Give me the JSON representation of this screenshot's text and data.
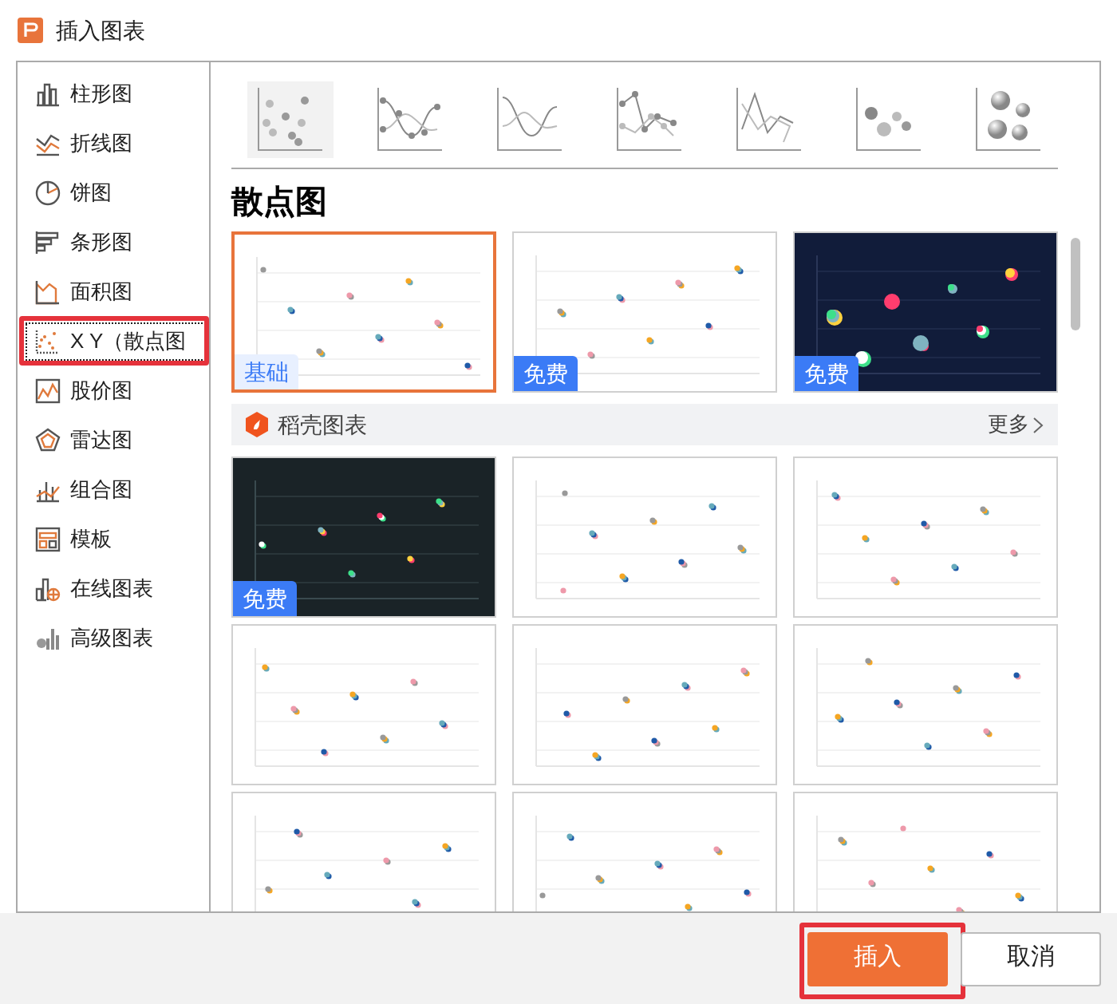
{
  "window": {
    "title": "插入图表"
  },
  "sidebar": {
    "items": [
      {
        "label": "柱形图",
        "kind": "column",
        "selected": false,
        "annotated": false
      },
      {
        "label": "折线图",
        "kind": "line",
        "selected": false,
        "annotated": false
      },
      {
        "label": "饼图",
        "kind": "pie",
        "selected": false,
        "annotated": false
      },
      {
        "label": "条形图",
        "kind": "bar",
        "selected": false,
        "annotated": false
      },
      {
        "label": "面积图",
        "kind": "area",
        "selected": false,
        "annotated": false
      },
      {
        "label": "X Y（散点图",
        "kind": "scatter",
        "selected": true,
        "annotated": true
      },
      {
        "label": "股价图",
        "kind": "stock",
        "selected": false,
        "annotated": false
      },
      {
        "label": "雷达图",
        "kind": "radar",
        "selected": false,
        "annotated": false
      },
      {
        "label": "组合图",
        "kind": "combo",
        "selected": false,
        "annotated": false
      },
      {
        "label": "模板",
        "kind": "template",
        "selected": false,
        "annotated": false
      },
      {
        "label": "在线图表",
        "kind": "online",
        "selected": false,
        "annotated": false
      },
      {
        "label": "高级图表",
        "kind": "advanced",
        "selected": false,
        "annotated": false
      }
    ]
  },
  "subtypes": [
    {
      "kind": "scatter",
      "selected": true
    },
    {
      "kind": "smooth-marker",
      "selected": false
    },
    {
      "kind": "smooth",
      "selected": false
    },
    {
      "kind": "line-marker",
      "selected": false
    },
    {
      "kind": "line",
      "selected": false
    },
    {
      "kind": "bubble",
      "selected": false
    },
    {
      "kind": "bubble-3d",
      "selected": false
    }
  ],
  "section_title": "散点图",
  "basic_templates": [
    {
      "kind": "light",
      "selected": true,
      "badge": {
        "text": "基础",
        "kind": "basic"
      }
    },
    {
      "kind": "light",
      "selected": false,
      "badge": {
        "text": "免费",
        "kind": "free"
      }
    },
    {
      "kind": "navy",
      "selected": false,
      "badge": {
        "text": "免费",
        "kind": "free"
      }
    }
  ],
  "docer": {
    "title": "稻壳图表",
    "more": "更多",
    "templates": [
      {
        "kind": "dark",
        "selected": false,
        "badge": {
          "text": "免费",
          "kind": "free"
        }
      },
      {
        "kind": "light",
        "selected": false
      },
      {
        "kind": "light",
        "selected": false
      },
      {
        "kind": "light",
        "selected": false
      },
      {
        "kind": "light",
        "selected": false
      },
      {
        "kind": "light",
        "selected": false
      },
      {
        "kind": "light",
        "selected": false
      },
      {
        "kind": "light",
        "selected": false
      },
      {
        "kind": "light",
        "selected": false
      }
    ]
  },
  "buttons": [
    {
      "label": "插入",
      "kind": "primary",
      "annotated": true
    },
    {
      "label": "取消",
      "kind": "secondary",
      "annotated": false
    }
  ]
}
